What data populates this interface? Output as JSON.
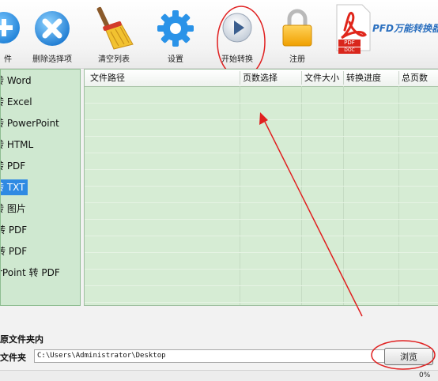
{
  "toolbar": {
    "items": [
      {
        "label": "件",
        "icon": "add-file-icon"
      },
      {
        "label": "删除选择项",
        "icon": "delete-icon"
      },
      {
        "label": "清空列表",
        "icon": "broom-icon"
      },
      {
        "label": "设置",
        "icon": "gear-icon"
      },
      {
        "label": "开始转换",
        "icon": "play-icon"
      },
      {
        "label": "注册",
        "icon": "lock-icon"
      }
    ],
    "logo_text": "PFD万能转换器",
    "logo_badge_1": "PDF",
    "logo_badge_2": "DOC"
  },
  "sidebar": {
    "items": [
      {
        "label": "转 Word"
      },
      {
        "label": "转 Excel"
      },
      {
        "label": "转 PowerPoint"
      },
      {
        "label": "转 HTML"
      },
      {
        "label": "转 PDF"
      },
      {
        "label": "转 TXT",
        "selected": true
      },
      {
        "label": "转 图片"
      },
      {
        "label": "转 PDF"
      },
      {
        "label": "转 PDF"
      },
      {
        "label": "rPoint 转 PDF"
      }
    ]
  },
  "table": {
    "columns": [
      "文件路径",
      "页数选择",
      "文件大小",
      "转换进度",
      "总页数"
    ],
    "rows": []
  },
  "output": {
    "save_to_source_label": "原文件夹内",
    "folder_label": "文件夹",
    "folder_path": "C:\\Users\\Administrator\\Desktop",
    "browse_label": "浏览"
  },
  "status": {
    "progress": "0%"
  },
  "colors": {
    "accent_blue": "#2f8ae3",
    "annotation_red": "#e02020",
    "list_green": "#d6ecd4"
  }
}
